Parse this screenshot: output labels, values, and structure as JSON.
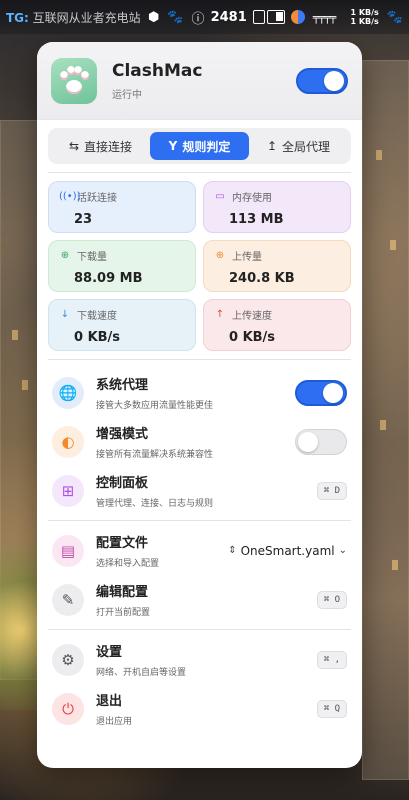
{
  "menubar": {
    "prefix": "TG:",
    "text": "互联网从业者充电站",
    "count": "2481",
    "net_glyph": "╤╤╤╤",
    "speed_up": "1 KB/s",
    "speed_down": "1 KB/s"
  },
  "app": {
    "name": "ClashMac",
    "status": "运行中",
    "enabled": true
  },
  "modes": [
    {
      "label": "直接连接",
      "icon": "⇆",
      "active": false
    },
    {
      "label": "规则判定",
      "icon": "Y",
      "active": true
    },
    {
      "label": "全局代理",
      "icon": "↥",
      "active": false
    }
  ],
  "stats": {
    "active_connections": {
      "label": "活跃连接",
      "value": "23"
    },
    "memory": {
      "label": "内存使用",
      "value": "113 MB"
    },
    "download_total": {
      "label": "下载量",
      "value": "88.09 MB"
    },
    "upload_total": {
      "label": "上传量",
      "value": "240.8 KB"
    },
    "download_speed": {
      "label": "下载速度",
      "value": "0 KB/s"
    },
    "upload_speed": {
      "label": "上传速度",
      "value": "0 KB/s"
    }
  },
  "rows": {
    "system_proxy": {
      "title": "系统代理",
      "sub": "接管大多数应用流量性能更佳",
      "enabled": true
    },
    "enhanced_mode": {
      "title": "增强模式",
      "sub": "接管所有流量解决系统兼容性",
      "enabled": false
    },
    "dashboard": {
      "title": "控制面板",
      "sub": "管理代理、连接、日志与规则",
      "shortcut": "⌘ D"
    },
    "config_file": {
      "title": "配置文件",
      "sub": "选择和导入配置",
      "selected": "OneSmart.yaml"
    },
    "edit_config": {
      "title": "编辑配置",
      "sub": "打开当前配置",
      "shortcut": "⌘ O"
    },
    "settings": {
      "title": "设置",
      "sub": "网络、开机自启等设置",
      "shortcut": "⌘ ,"
    },
    "quit": {
      "title": "退出",
      "sub": "退出应用",
      "shortcut": "⌘ Q"
    }
  },
  "colors": {
    "accent": "#2d6ff0"
  }
}
